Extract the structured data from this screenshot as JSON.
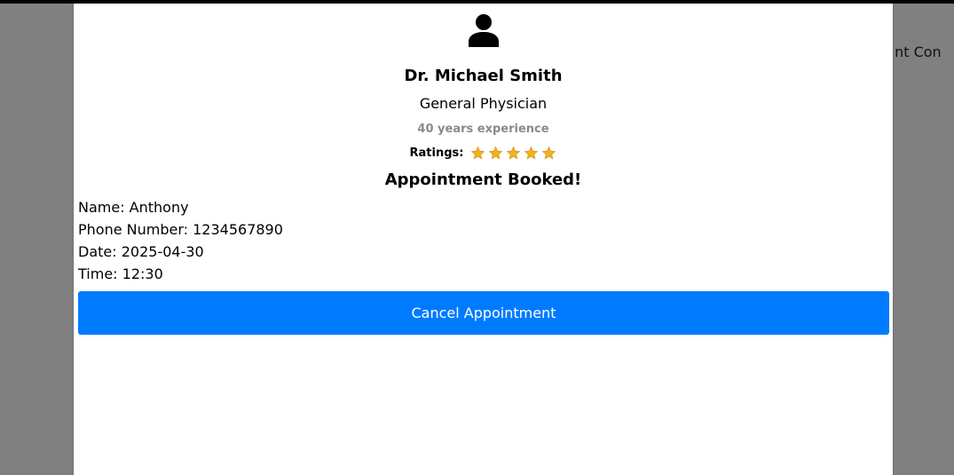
{
  "background": {
    "partial_text": "tant Con"
  },
  "doctor": {
    "avatar_icon": "person-icon",
    "name": "Dr. Michael Smith",
    "specialty": "General Physician",
    "experience": "40 years experience",
    "ratings_label": "Ratings:",
    "rating_value": 5,
    "rating_max": 5,
    "star_color": "#f2b01e"
  },
  "booking": {
    "title": "Appointment Booked!",
    "name_line": "Name: Anthony",
    "phone_line": "Phone Number: 1234567890",
    "date_line": "Date: 2025-04-30",
    "time_line": "Time: 12:30"
  },
  "actions": {
    "cancel_label": "Cancel Appointment",
    "cancel_color": "#007bff"
  }
}
